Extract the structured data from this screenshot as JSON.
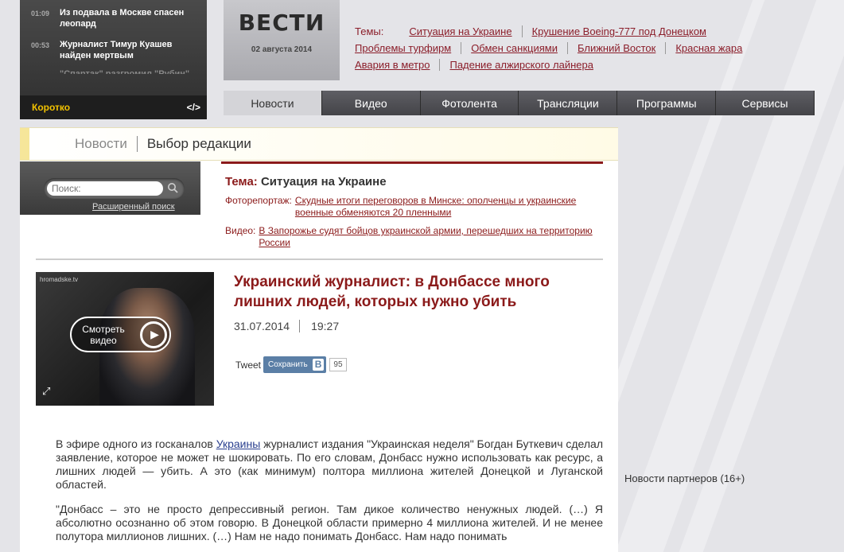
{
  "ticker": {
    "items": [
      {
        "time": "01:09",
        "text": "Из подвала в Москве спасен леопард"
      },
      {
        "time": "00:53",
        "text": "Журналист Тимур Куашев найден мертвым"
      },
      {
        "time": "",
        "text": "\"Спартак\" разгромил \"Рубин\""
      }
    ],
    "footer_label": "Коротко",
    "footer_code": "</>"
  },
  "header": {
    "logo": "ВЕСТИ",
    "date": "02 августа 2014",
    "topics_label": "Темы:",
    "topics": [
      "Ситуация на Украине",
      "Крушение Boeing-777 под Донецком",
      "Проблемы турфирм",
      "Обмен санкциями",
      "Ближний Восток",
      "Красная жара",
      "Авария в метро",
      "Падение алжирского лайнера"
    ]
  },
  "nav": {
    "tabs": [
      "Новости",
      "Видео",
      "Фотолента",
      "Трансляции",
      "Программы",
      "Сервисы"
    ]
  },
  "breadcrumb": {
    "first": "Новости",
    "second": "Выбор редакции"
  },
  "search": {
    "placeholder": "Поиск:",
    "advanced": "Расширенный поиск"
  },
  "topic": {
    "label": "Тема:",
    "name": "Ситуация на Украине",
    "rows": [
      {
        "key": "Фоторепортаж:",
        "text": "Скудные итоги переговоров в Минске: ополченцы и украинские военные обменяются 20 пленными"
      },
      {
        "key": "Видео:",
        "text": "В Запорожье судят бойцов украинской армии, перешедших на территорию России"
      }
    ]
  },
  "video": {
    "watermark": "hromadske.tv",
    "play_label": "Смотреть видео"
  },
  "article": {
    "headline": "Украинский журналист: в Донбассе много лишних людей, которых нужно убить",
    "date": "31.07.2014",
    "time": "19:27",
    "tweet": "Tweet",
    "save": "Сохранить",
    "vk": "В",
    "count": "95",
    "p1_before": "В эфире одного из госканалов ",
    "p1_link": "Украины",
    "p1_after": " журналист издания \"Украинская неделя\" Богдан Буткевич сделал заявление, которое не может не шокировать. По его словам, Донбасс нужно использовать как ресурс, а лишних людей — убить. А это (как минимум) полтора миллиона жителей Донецкой и Луганской областей.",
    "p2": "\"Донбасс – это не просто депрессивный регион. Там дикое количество ненужных людей. (…) Я абсолютно осознанно об этом говорю. В Донецкой области примерно 4 миллиона жителей. И не менее полутора миллионов лишних. (…) Нам не надо понимать Донбасс. Нам надо понимать"
  },
  "sidebar": {
    "partners": "Новости партнеров (16+)"
  }
}
